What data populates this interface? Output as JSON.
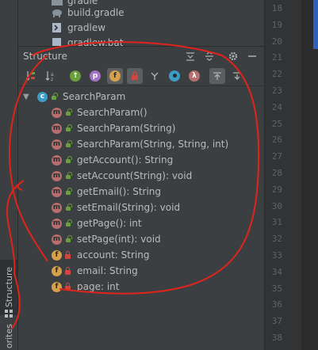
{
  "project_tree": [
    {
      "label": "gradle",
      "icon": "folder-icon"
    },
    {
      "label": "build.gradle",
      "icon": "gradle-elephant-icon"
    },
    {
      "label": "gradlew",
      "icon": "terminal-file-icon"
    },
    {
      "label": "gradlew.bat",
      "icon": "file-icon"
    }
  ],
  "structure_panel": {
    "title": "Structure",
    "header_buttons": [
      "expand-all-icon",
      "collapse-all-icon",
      "gear-icon",
      "minimize-icon"
    ],
    "toolbar": [
      "sort-by-visibility-icon",
      "sort-alphabetically-icon",
      "show-inherited-icon",
      "show-properties-icon",
      "show-fields-icon",
      "show-non-public-icon",
      "show-anonymous-icon",
      "show-lambdas-icon",
      "autoscroll-to-source-icon",
      "autoscroll-from-source-icon"
    ]
  },
  "tree": {
    "class_name": "SearchParam",
    "members": [
      {
        "kind": "m",
        "visibility": "public",
        "label": "SearchParam()"
      },
      {
        "kind": "m",
        "visibility": "public",
        "label": "SearchParam(String)"
      },
      {
        "kind": "m",
        "visibility": "public",
        "label": "SearchParam(String, String, int)"
      },
      {
        "kind": "m",
        "visibility": "public",
        "label": "getAccount(): String"
      },
      {
        "kind": "m",
        "visibility": "public",
        "label": "setAccount(String): void"
      },
      {
        "kind": "m",
        "visibility": "public",
        "label": "getEmail(): String"
      },
      {
        "kind": "m",
        "visibility": "public",
        "label": "setEmail(String): void"
      },
      {
        "kind": "m",
        "visibility": "public",
        "label": "getPage(): int"
      },
      {
        "kind": "m",
        "visibility": "public",
        "label": "setPage(int): void"
      },
      {
        "kind": "f",
        "visibility": "private",
        "label": "account: String"
      },
      {
        "kind": "f",
        "visibility": "private",
        "label": "email: String"
      },
      {
        "kind": "f",
        "visibility": "private",
        "label": "page: int"
      }
    ]
  },
  "side_tabs": {
    "structure": "Structure",
    "favorites": "orites"
  },
  "line_numbers": [
    "18",
    "19",
    "20",
    "21",
    "22",
    "23",
    "24",
    "25",
    "26",
    "27",
    "28",
    "29",
    "30",
    "31",
    "32",
    "33",
    "34",
    "35",
    "36",
    "37",
    "38"
  ],
  "colors": {
    "accent_blue": "#2f65ca",
    "annotation_red": "#e0241c",
    "method_badge": "#b76e6e",
    "field_badge": "#d6a04a"
  }
}
